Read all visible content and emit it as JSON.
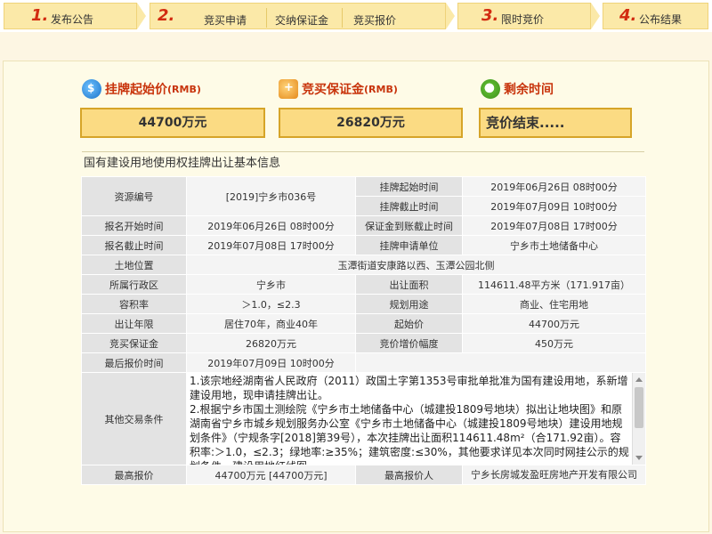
{
  "steps": [
    {
      "num": "1.",
      "label": "发布公告"
    },
    {
      "num": "2.",
      "substeps": [
        "竞买申请",
        "交纳保证金",
        "竞买报价"
      ]
    },
    {
      "num": "3.",
      "label": "限时竞价"
    },
    {
      "num": "4.",
      "label": "公布结果"
    }
  ],
  "summary": {
    "start_price": {
      "label": "挂牌起始价",
      "unit": "(RMB)",
      "value": "44700万元",
      "icon": "money-bag-icon"
    },
    "deposit": {
      "label": "竞买保证金",
      "unit": "(RMB)",
      "value": "26820万元",
      "icon": "deposit-icon"
    },
    "remaining": {
      "label": "剩余时间",
      "value": "竞价结束.....",
      "icon": "alarm-clock-icon"
    }
  },
  "section_title": "国有建设用地使用权挂牌出让基本信息",
  "info": {
    "resource_no": {
      "label": "资源编号",
      "value": "[2019]宁乡市036号"
    },
    "listing_start": {
      "label": "挂牌起始时间",
      "value": "2019年06月26日 08时00分"
    },
    "listing_end": {
      "label": "挂牌截止时间",
      "value": "2019年07月09日 10时00分"
    },
    "signup_start": {
      "label": "报名开始时间",
      "value": "2019年06月26日 08时00分"
    },
    "deposit_deadline": {
      "label": "保证金到账截止时间",
      "value": "2019年07月08日 17时00分"
    },
    "signup_end": {
      "label": "报名截止时间",
      "value": "2019年07月08日 17时00分"
    },
    "apply_unit": {
      "label": "挂牌申请单位",
      "value": "宁乡市土地储备中心"
    },
    "location": {
      "label": "土地位置",
      "value": "玉潭街道安康路以西、玉潭公园北侧"
    },
    "district": {
      "label": "所属行政区",
      "value": "宁乡市"
    },
    "area": {
      "label": "出让面积",
      "value": "114611.48平方米（171.917亩）"
    },
    "plot_ratio": {
      "label": "容积率",
      "value": "＞1.0，≤2.3"
    },
    "usage": {
      "label": "规划用途",
      "value": "商业、住宅用地"
    },
    "term": {
      "label": "出让年限",
      "value": "居住70年，商业40年"
    },
    "start_price": {
      "label": "起始价",
      "value": "44700万元"
    },
    "bid_deposit": {
      "label": "竞买保证金",
      "value": "26820万元"
    },
    "increment": {
      "label": "竞价增价幅度",
      "value": "450万元"
    },
    "last_bid_time": {
      "label": "最后报价时间",
      "value": "2019年07月09日 10时00分"
    },
    "other_terms": {
      "label": "其他交易条件",
      "paragraphs": [
        "1.该宗地经湖南省人民政府（2011）政国土字第1353号审批单批准为国有建设用地，系新增建设用地，现申请挂牌出让。",
        "2.根据宁乡市国土测绘院《宁乡市土地储备中心（城建投1809号地块）拟出让地块图》和原湖南省宁乡市城乡规划服务办公室《宁乡市土地储备中心（城建投1809号地块）建设用地规划条件》（宁规条字[2018]第39号），本次挂牌出让面积114611.48m²（合171.92亩）。容积率:＞1.0，≤2.3；绿地率:≥35%；建筑密度:≤30%，其他要求详见本次同时网挂公示的规划条件，建设用地红线图。"
      ]
    },
    "highest_bid": {
      "label": "最高报价",
      "value": "44700万元 [44700万元]"
    },
    "highest_bidder": {
      "label": "最高报价人",
      "value": "宁乡长房城发盈旺房地产开发有限公司"
    }
  },
  "colors": {
    "accent": "#c8340c",
    "step_bg": "#fbe9a8",
    "summary_box": "#fbdb83",
    "panel_bg": "#fefbe7"
  }
}
